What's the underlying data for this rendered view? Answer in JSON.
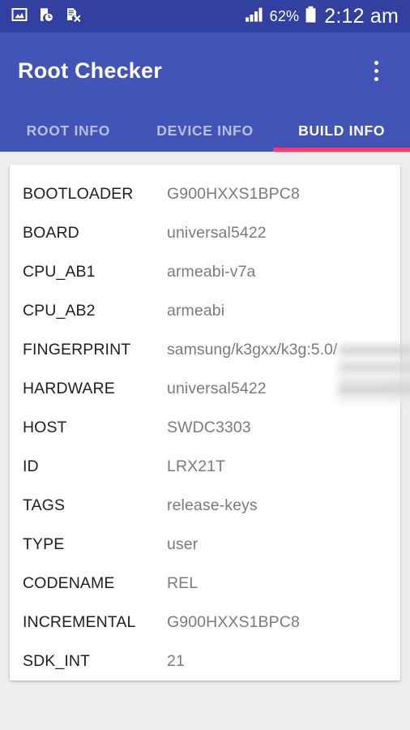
{
  "status_bar": {
    "background_color": "#32409F",
    "icons": [
      "image-icon",
      "device-clock-icon",
      "file-cancel-icon",
      "signal-bars-icon",
      "battery-icon"
    ],
    "battery_percent": "62%",
    "clock": "2:12 am"
  },
  "app_bar": {
    "background_color": "#4254B5",
    "title": "Root Checker",
    "overflow_menu": "overflow-menu-icon"
  },
  "tabs": {
    "indicator_color": "#F8396C",
    "active_index": 2,
    "items": [
      {
        "label": "ROOT INFO"
      },
      {
        "label": "DEVICE INFO"
      },
      {
        "label": "BUILD INFO"
      }
    ]
  },
  "build_info": {
    "label_color": "#1F1F1F",
    "value_color": "#7B7B7B",
    "rows": [
      {
        "label": "BOOTLOADER",
        "value": "G900HXXS1BPC8"
      },
      {
        "label": "BOARD",
        "value": "universal5422"
      },
      {
        "label": "CPU_AB1",
        "value": "armeabi-v7a"
      },
      {
        "label": "CPU_AB2",
        "value": "armeabi"
      },
      {
        "label": "FINGERPRINT",
        "value": "samsung/k3gxx/k3g:5.0/",
        "redacted": true
      },
      {
        "label": "HARDWARE",
        "value": "universal5422"
      },
      {
        "label": "HOST",
        "value": "SWDC3303"
      },
      {
        "label": "ID",
        "value": "LRX21T"
      },
      {
        "label": "TAGS",
        "value": "release-keys"
      },
      {
        "label": "TYPE",
        "value": "user"
      },
      {
        "label": "CODENAME",
        "value": "REL"
      },
      {
        "label": "INCREMENTAL",
        "value": "G900HXXS1BPC8"
      },
      {
        "label": "SDK_INT",
        "value": "21"
      }
    ]
  }
}
